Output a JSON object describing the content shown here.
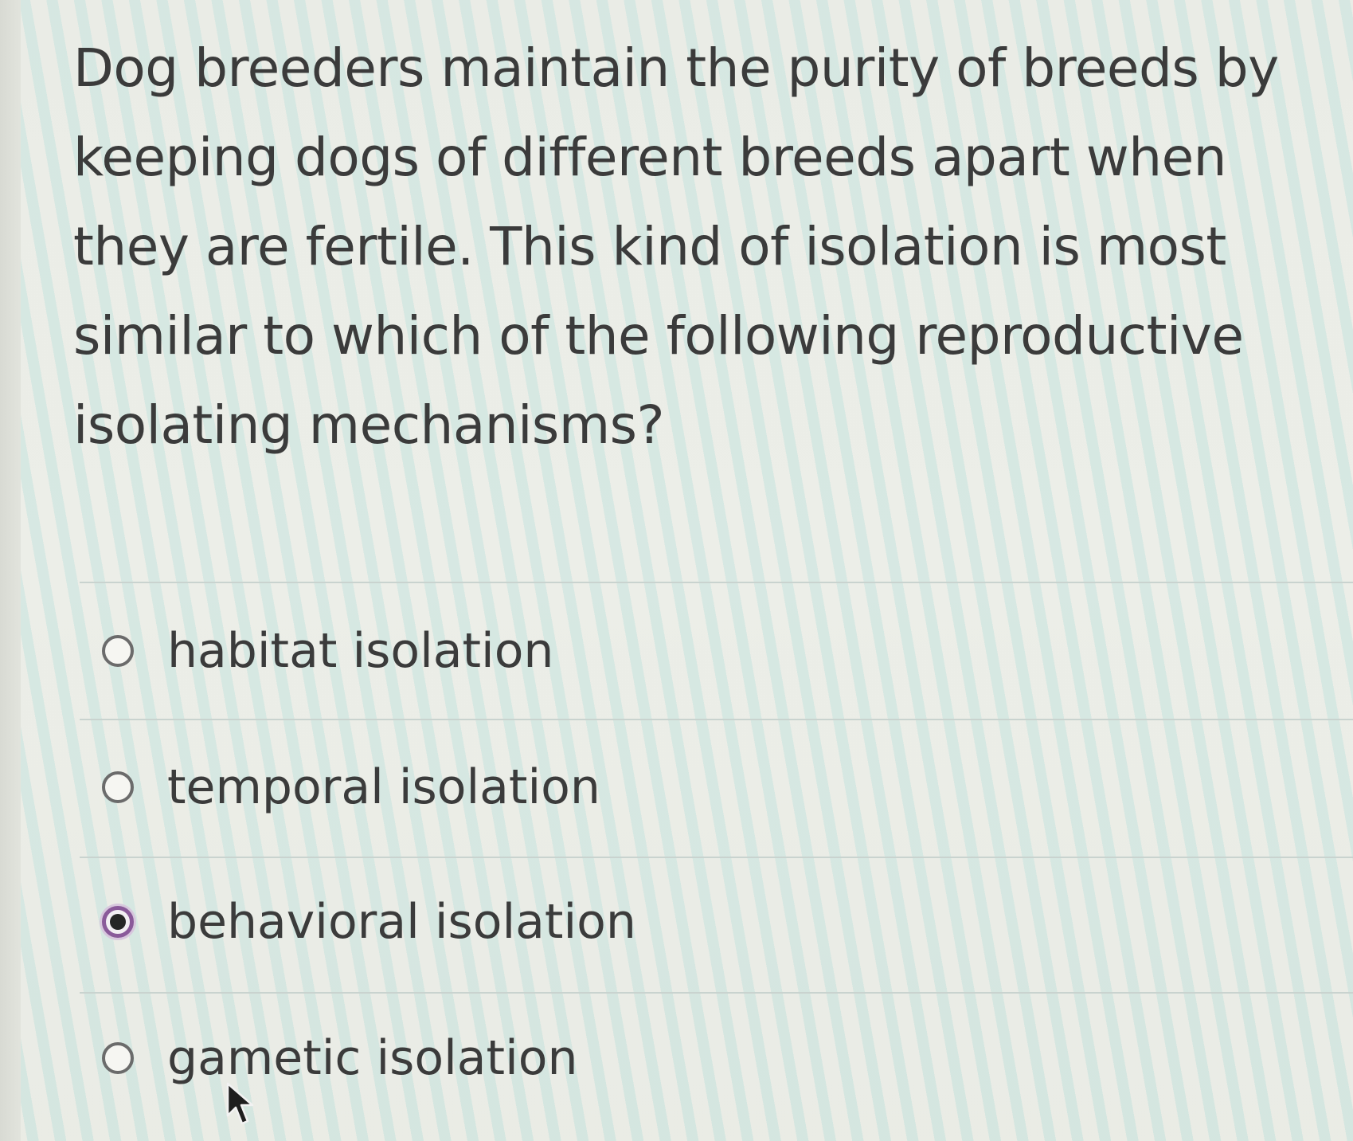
{
  "question": {
    "text": "Dog breeders maintain the purity of breeds by keeping dogs of different breeds apart when they are fertile. This kind of isolation is most similar to which of the following reproductive isolating mechanisms?"
  },
  "options": [
    {
      "label": "habitat isolation",
      "selected": false
    },
    {
      "label": "temporal isolation",
      "selected": false
    },
    {
      "label": "behavioral isolation",
      "selected": true
    },
    {
      "label": "gametic isolation",
      "selected": false
    }
  ],
  "colors": {
    "text": "#3b3b3b",
    "selected_ring": "#8a5a9a",
    "divider": "#c9d3cf"
  },
  "icons": {
    "pointer": "mouse-pointer-icon"
  }
}
